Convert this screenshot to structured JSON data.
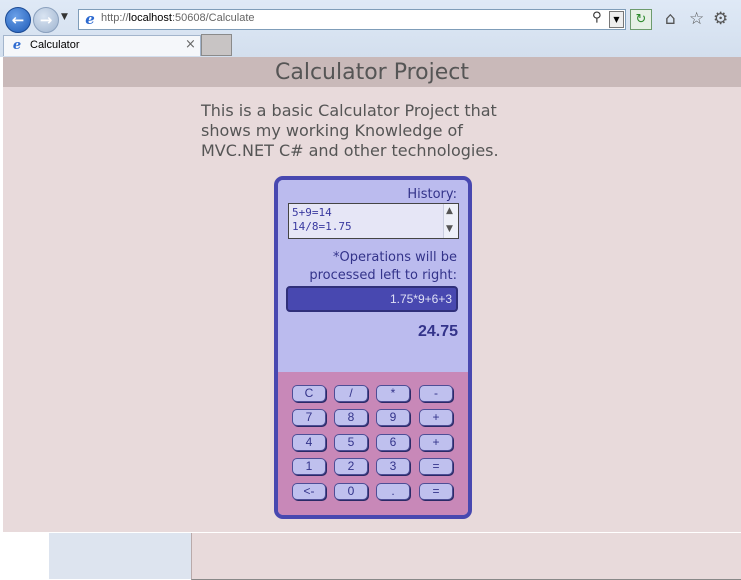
{
  "browser": {
    "address": {
      "host": "localhost",
      "prefix": "http://",
      "suffix": ":50608/Calculate"
    },
    "tab": {
      "label": "Calculator",
      "close": "×"
    },
    "icons": [
      "back-icon",
      "forward-icon",
      "ie-icon",
      "search-icon",
      "refresh-icon",
      "home-icon",
      "favorites-icon",
      "tools-icon"
    ]
  },
  "page": {
    "header": "Calculator Project",
    "intro": "This is a basic Calculator Project that shows my working Knowledge of MVC.NET C# and other technologies."
  },
  "calculator": {
    "history_label": "History:",
    "history": [
      "5+9=14",
      "14/8=1.75"
    ],
    "note_line1": "*Operations will be",
    "note_line2": "processed left to right:",
    "display": "1.75*9+6+3",
    "result": "24.75",
    "keys": [
      [
        "C",
        "/",
        "*",
        "-"
      ],
      [
        "7",
        "8",
        "9",
        "+"
      ],
      [
        "4",
        "5",
        "6",
        "+"
      ],
      [
        "1",
        "2",
        "3",
        "="
      ],
      [
        "<-",
        "0",
        ".",
        "="
      ]
    ]
  },
  "colors": {
    "page_bg": "#e8dadb",
    "header_bg": "#c9b9b9",
    "calc_border": "#4848b0",
    "calc_top": "#bbbbee",
    "calc_keys_bg": "#c888b8",
    "display_bg": "#4848b0"
  }
}
